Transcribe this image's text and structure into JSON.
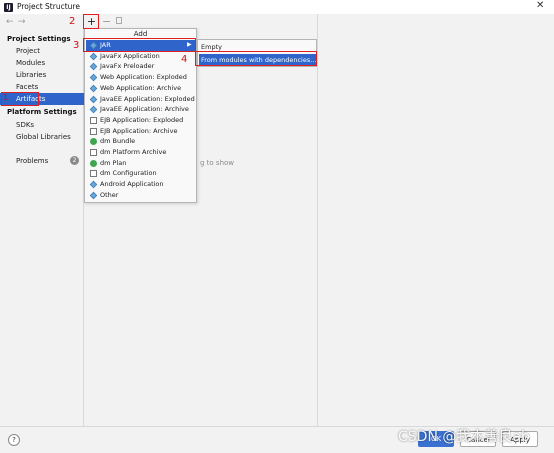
{
  "window": {
    "title": "Project Structure",
    "app_icon": "intellij-icon"
  },
  "nav": {
    "project_settings_header": "Project Settings",
    "project_settings": [
      "Project",
      "Modules",
      "Libraries",
      "Facets",
      "Artifacts"
    ],
    "platform_settings_header": "Platform Settings",
    "platform_settings": [
      "SDKs",
      "Global Libraries"
    ],
    "problems": "Problems",
    "problems_count": "2",
    "selected": "Artifacts"
  },
  "toolbar": {
    "add": "+",
    "remove": "−"
  },
  "add_menu": {
    "title": "Add",
    "items": [
      {
        "label": "JAR",
        "icon": "diamond"
      },
      {
        "label": "JavaFx Application",
        "icon": "diamond"
      },
      {
        "label": "JavaFx Preloader",
        "icon": "diamond"
      },
      {
        "label": "Web Application: Exploded",
        "icon": "diamond"
      },
      {
        "label": "Web Application: Archive",
        "icon": "diamond"
      },
      {
        "label": "JavaEE Application: Exploded",
        "icon": "diamond"
      },
      {
        "label": "JavaEE Application: Archive",
        "icon": "diamond"
      },
      {
        "label": "EJB Application: Exploded",
        "icon": "doc"
      },
      {
        "label": "EJB Application: Archive",
        "icon": "doc"
      },
      {
        "label": "dm Bundle",
        "icon": "circle"
      },
      {
        "label": "dm Platform Archive",
        "icon": "doc"
      },
      {
        "label": "dm Plan",
        "icon": "circle"
      },
      {
        "label": "dm Configuration",
        "icon": "doc"
      },
      {
        "label": "Android Application",
        "icon": "diamond"
      },
      {
        "label": "Other",
        "icon": "diamond"
      }
    ],
    "selected": "JAR"
  },
  "jar_submenu": {
    "items": [
      "Empty",
      "From modules with dependencies..."
    ],
    "selected": "From modules with dependencies..."
  },
  "empty_hint": "g to show",
  "annotations": [
    "1",
    "2",
    "3",
    "4"
  ],
  "buttons": {
    "help": "?",
    "ok": "OK",
    "cancel": "Cancel",
    "apply": "Apply"
  },
  "watermark": "CSDN @我本善良ab",
  "colors": {
    "selection": "#2f65ca",
    "annotation": "#e02020"
  }
}
